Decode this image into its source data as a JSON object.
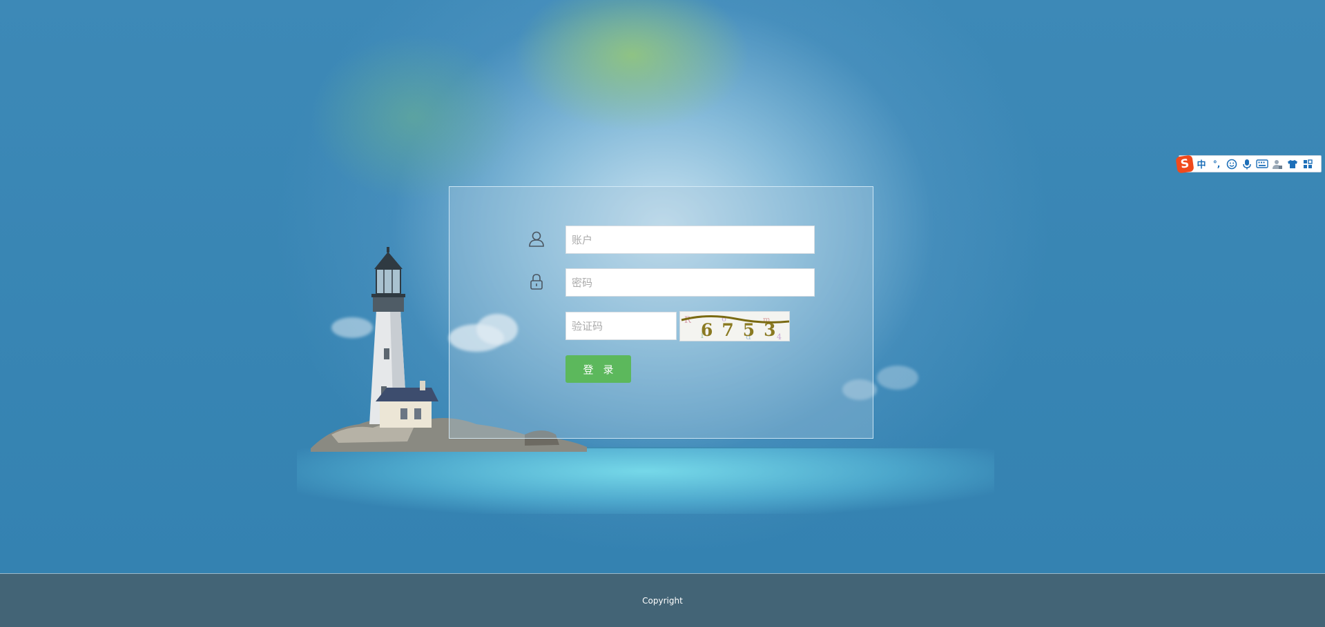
{
  "login": {
    "account_placeholder": "账户",
    "password_placeholder": "密码",
    "captcha_placeholder": "验证码",
    "captcha_code": "6753",
    "submit_label": "登录"
  },
  "footer": {
    "copyright": "Copyright"
  },
  "ime_toolbar": {
    "chinese_mode_label": "中",
    "punctuation_label": "°,",
    "items": [
      "sogou-logo-icon",
      "emoji-icon",
      "microphone-icon",
      "keyboard-icon",
      "user-icon",
      "skin-shirt-icon",
      "grid-menu-icon"
    ]
  },
  "colors": {
    "background_blue": "#3a86b4",
    "login_button_green": "#5cb85c",
    "footer_bg": "#436476",
    "ime_accent": "#1d6fb8",
    "ime_logo": "#f04a1c"
  }
}
